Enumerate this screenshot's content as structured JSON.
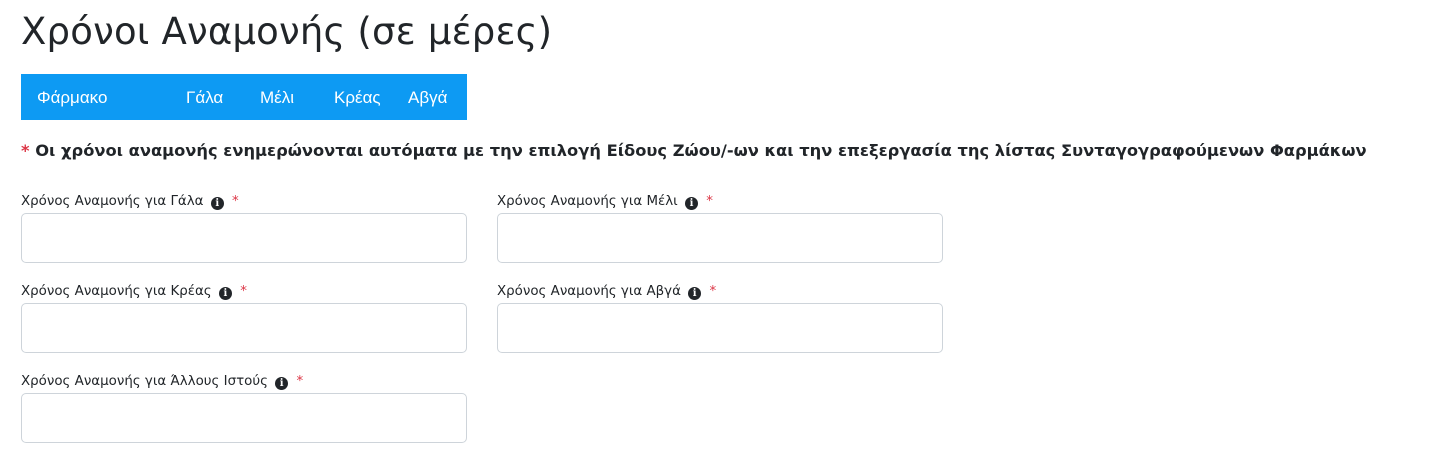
{
  "page": {
    "title": "Χρόνοι Αναμονής (σε μέρες)"
  },
  "table_header": {
    "columns": [
      "Φάρμακο",
      "Γάλα",
      "Μέλι",
      "Κρέας",
      "Αβγά"
    ],
    "background": "#0d9af3"
  },
  "notice": {
    "asterisk": "*",
    "text": "Οι χρόνοι αναμονής ενημερώνονται αυτόματα με την επιλογή Είδους Ζώου/-ων και την επεξεργασία της λίστας Συνταγογραφούμενων Φαρμάκων"
  },
  "form": {
    "required_marker": "*",
    "info_icon": "info-circle-icon",
    "fields": [
      {
        "label": "Χρόνος Αναμονής για Γάλα",
        "value": "",
        "placeholder": ""
      },
      {
        "label": "Χρόνος Αναμονής για Μέλι",
        "value": "",
        "placeholder": ""
      },
      {
        "label": "Χρόνος Αναμονής για Κρέας",
        "value": "",
        "placeholder": ""
      },
      {
        "label": "Χρόνος Αναμονής για Αβγά",
        "value": "",
        "placeholder": ""
      },
      {
        "label": "Χρόνος Αναμονής για Άλλους Ιστούς",
        "value": "",
        "placeholder": ""
      }
    ]
  },
  "colors": {
    "required": "#dc3545",
    "text": "#212529",
    "input_border": "#ced4da"
  }
}
